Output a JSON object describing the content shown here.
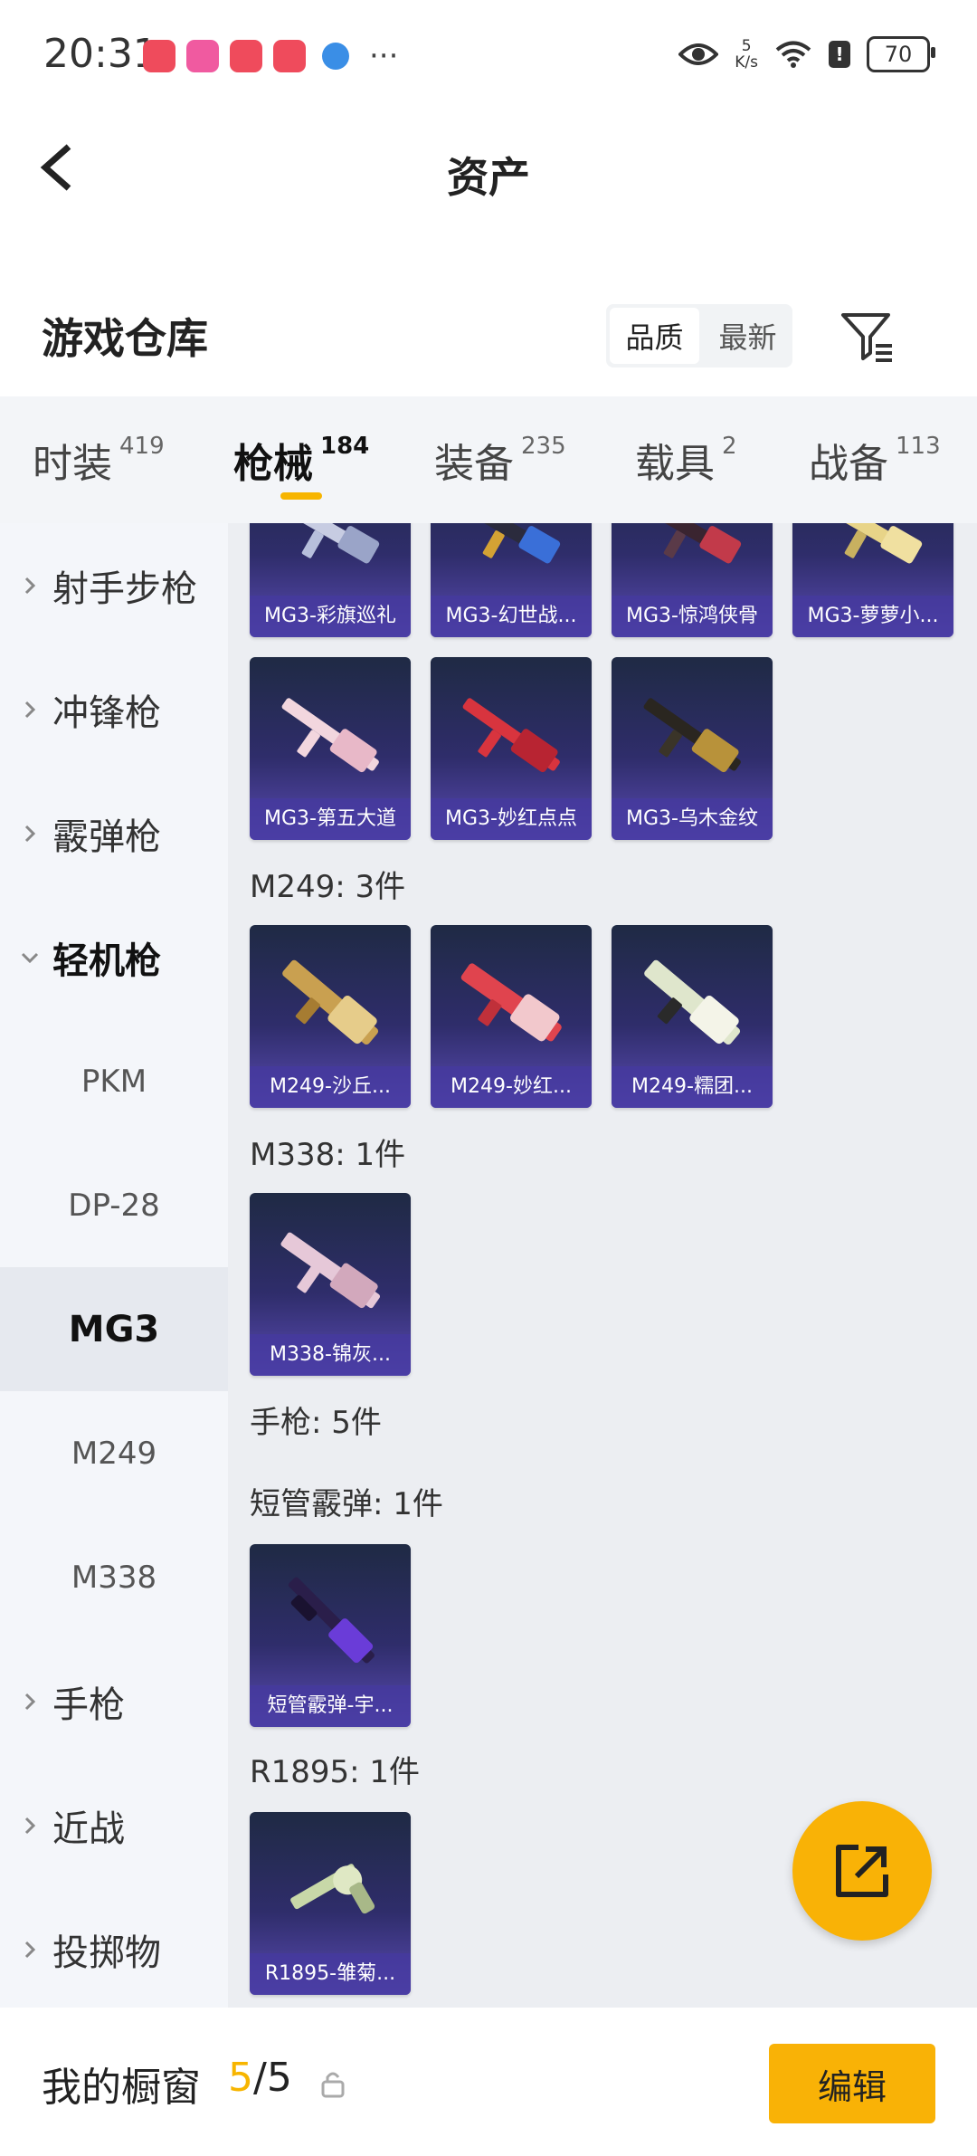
{
  "status_bar": {
    "time": "20:31",
    "speed_value": "5",
    "speed_unit": "K/s",
    "battery": "70",
    "more": "···"
  },
  "nav": {
    "title": "资产"
  },
  "warehouse": {
    "title": "游戏仓库",
    "sort_options": [
      "品质",
      "最新"
    ],
    "sort_selected": "品质"
  },
  "category_tabs": [
    {
      "label": "时装",
      "count": "419"
    },
    {
      "label": "枪械",
      "count": "184",
      "active": true
    },
    {
      "label": "装备",
      "count": "235"
    },
    {
      "label": "载具",
      "count": "2"
    },
    {
      "label": "战备",
      "count": "113"
    }
  ],
  "sidebar": {
    "items": [
      {
        "label": "射手步枪"
      },
      {
        "label": "冲锋枪"
      },
      {
        "label": "霰弹枪"
      },
      {
        "label": "轻机枪",
        "expanded": true
      },
      {
        "label": "手枪"
      },
      {
        "label": "近战"
      },
      {
        "label": "投掷物"
      }
    ],
    "sub_items": [
      "PKM",
      "DP-28",
      "MG3",
      "M249",
      "M338"
    ],
    "active_sub": "MG3"
  },
  "content": {
    "row_top": [
      "MG3-彩旗巡礼",
      "MG3-幻世战...",
      "MG3-惊鸿侠骨",
      "MG3-萝萝小..."
    ],
    "row_mg3": [
      "MG3-第五大道",
      "MG3-妙红点点",
      "MG3-乌木金纹"
    ],
    "groups": [
      {
        "label": "M249: 3件",
        "items": [
          "M249-沙丘...",
          "M249-妙红...",
          "M249-糯团..."
        ]
      },
      {
        "label": "M338: 1件",
        "items": [
          "M338-锦灰..."
        ]
      },
      {
        "label": "手枪: 5件",
        "items": []
      },
      {
        "label": "短管霰弹: 1件",
        "items": [
          "短管霰弹-宇..."
        ]
      },
      {
        "label": "R1895: 1件",
        "items": [
          "R1895-雏菊..."
        ]
      }
    ]
  },
  "bottom": {
    "showcase_label": "我的橱窗",
    "showcase_current": "5",
    "showcase_sep": "/",
    "showcase_total": "5",
    "edit_label": "编辑"
  },
  "colors": {
    "accent": "#f9b206",
    "card_top": "#1f2a44",
    "card_bottom": "#5a4bb3"
  },
  "icons": [
    "back-arrow-icon",
    "filter-icon",
    "share-icon",
    "lock-icon",
    "chevron-right-icon",
    "chevron-down-icon",
    "eye-icon",
    "wifi-icon"
  ]
}
